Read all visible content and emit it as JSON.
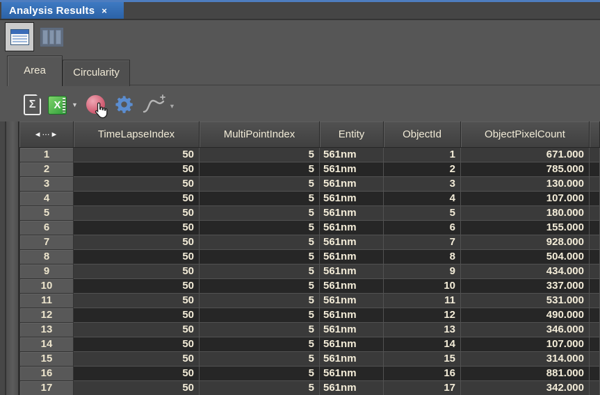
{
  "window": {
    "title": "Analysis Results",
    "close_label": "×"
  },
  "colors": {
    "accent_blue": "#2e6cb4",
    "top_strip_blue": "#4e7dbf",
    "panel_gray": "#565656",
    "excel_green": "#3fae49",
    "gear_blue": "#5b8dd0",
    "record_pink": "#d25f74",
    "row_odd": "#3a3a3a",
    "row_even": "#262626"
  },
  "view_toolbar": {
    "buttons": [
      {
        "name": "single-table-view",
        "selected": true
      },
      {
        "name": "column-layout-view",
        "selected": false
      }
    ]
  },
  "tabs": [
    {
      "label": "Area",
      "active": true
    },
    {
      "label": "Circularity",
      "active": false
    }
  ],
  "toolbar": {
    "sigma_glyph": "Σ",
    "excel_glyph": "X",
    "dropdown_glyph": "▼",
    "icons": [
      "export-report-sigma",
      "export-excel",
      "record-button",
      "settings-gear",
      "add-graph-curve"
    ]
  },
  "table": {
    "nav_icon": "◄⋯►",
    "columns": [
      {
        "key": "row",
        "label": ""
      },
      {
        "key": "TimeLapseIndex",
        "label": "TimeLapseIndex"
      },
      {
        "key": "MultiPointIndex",
        "label": "MultiPointIndex"
      },
      {
        "key": "Entity",
        "label": "Entity"
      },
      {
        "key": "ObjectId",
        "label": "ObjectId"
      },
      {
        "key": "ObjectPixelCount",
        "label": "ObjectPixelCount"
      }
    ],
    "rows": [
      {
        "n": 1,
        "TimeLapseIndex": 50,
        "MultiPointIndex": 5,
        "Entity": "561nm",
        "ObjectId": 1,
        "ObjectPixelCount": "671.000"
      },
      {
        "n": 2,
        "TimeLapseIndex": 50,
        "MultiPointIndex": 5,
        "Entity": "561nm",
        "ObjectId": 2,
        "ObjectPixelCount": "785.000"
      },
      {
        "n": 3,
        "TimeLapseIndex": 50,
        "MultiPointIndex": 5,
        "Entity": "561nm",
        "ObjectId": 3,
        "ObjectPixelCount": "130.000"
      },
      {
        "n": 4,
        "TimeLapseIndex": 50,
        "MultiPointIndex": 5,
        "Entity": "561nm",
        "ObjectId": 4,
        "ObjectPixelCount": "107.000"
      },
      {
        "n": 5,
        "TimeLapseIndex": 50,
        "MultiPointIndex": 5,
        "Entity": "561nm",
        "ObjectId": 5,
        "ObjectPixelCount": "180.000"
      },
      {
        "n": 6,
        "TimeLapseIndex": 50,
        "MultiPointIndex": 5,
        "Entity": "561nm",
        "ObjectId": 6,
        "ObjectPixelCount": "155.000"
      },
      {
        "n": 7,
        "TimeLapseIndex": 50,
        "MultiPointIndex": 5,
        "Entity": "561nm",
        "ObjectId": 7,
        "ObjectPixelCount": "928.000"
      },
      {
        "n": 8,
        "TimeLapseIndex": 50,
        "MultiPointIndex": 5,
        "Entity": "561nm",
        "ObjectId": 8,
        "ObjectPixelCount": "504.000"
      },
      {
        "n": 9,
        "TimeLapseIndex": 50,
        "MultiPointIndex": 5,
        "Entity": "561nm",
        "ObjectId": 9,
        "ObjectPixelCount": "434.000"
      },
      {
        "n": 10,
        "TimeLapseIndex": 50,
        "MultiPointIndex": 5,
        "Entity": "561nm",
        "ObjectId": 10,
        "ObjectPixelCount": "337.000"
      },
      {
        "n": 11,
        "TimeLapseIndex": 50,
        "MultiPointIndex": 5,
        "Entity": "561nm",
        "ObjectId": 11,
        "ObjectPixelCount": "531.000"
      },
      {
        "n": 12,
        "TimeLapseIndex": 50,
        "MultiPointIndex": 5,
        "Entity": "561nm",
        "ObjectId": 12,
        "ObjectPixelCount": "490.000"
      },
      {
        "n": 13,
        "TimeLapseIndex": 50,
        "MultiPointIndex": 5,
        "Entity": "561nm",
        "ObjectId": 13,
        "ObjectPixelCount": "346.000"
      },
      {
        "n": 14,
        "TimeLapseIndex": 50,
        "MultiPointIndex": 5,
        "Entity": "561nm",
        "ObjectId": 14,
        "ObjectPixelCount": "107.000"
      },
      {
        "n": 15,
        "TimeLapseIndex": 50,
        "MultiPointIndex": 5,
        "Entity": "561nm",
        "ObjectId": 15,
        "ObjectPixelCount": "314.000"
      },
      {
        "n": 16,
        "TimeLapseIndex": 50,
        "MultiPointIndex": 5,
        "Entity": "561nm",
        "ObjectId": 16,
        "ObjectPixelCount": "881.000"
      },
      {
        "n": 17,
        "TimeLapseIndex": 50,
        "MultiPointIndex": 5,
        "Entity": "561nm",
        "ObjectId": 17,
        "ObjectPixelCount": "342.000"
      }
    ]
  }
}
